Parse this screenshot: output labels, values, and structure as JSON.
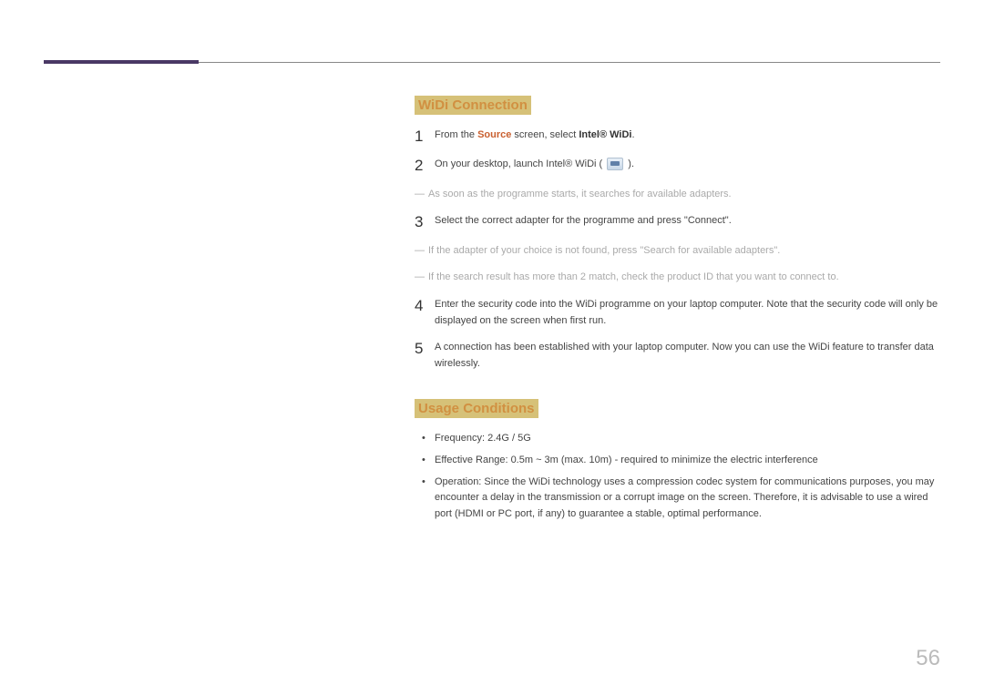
{
  "headings": {
    "widi": "WiDi Connection",
    "usage": "Usage Conditions"
  },
  "steps": {
    "s1_pre": "From the ",
    "s1_hl": "Source",
    "s1_mid": " screen, select ",
    "s1_bold": "Intel® WiDi",
    "s1_post": ".",
    "s2_pre": "On your desktop, launch Intel® WiDi ( ",
    "s2_post": " ).",
    "note1": "As soon as the programme starts, it searches for available adapters.",
    "s3": "Select the correct adapter for the programme and press \"Connect\".",
    "note2": "If the adapter of your choice is not found, press \"Search for available adapters\".",
    "note3": "If the search result has more than 2 match, check the product ID that you want to connect to.",
    "s4": "Enter the security code into the WiDi programme on your laptop computer. Note that the security code will only be displayed on the screen when first run.",
    "s5": "A connection has been established with your laptop computer. Now you can use the WiDi feature to transfer data wirelessly."
  },
  "numbers": {
    "n1": "1",
    "n2": "2",
    "n3": "3",
    "n4": "4",
    "n5": "5"
  },
  "bullets": {
    "b1": "Frequency: 2.4G / 5G",
    "b2": "Effective Range: 0.5m ~ 3m (max. 10m) - required to minimize the electric interference",
    "b3": "Operation: Since the WiDi technology uses a compression codec system for communications purposes, you may encounter a delay in the transmission or a corrupt image on the screen. Therefore, it is advisable to use a wired port (HDMI or PC port, if any) to guarantee a stable, optimal performance."
  },
  "pageNumber": "56"
}
